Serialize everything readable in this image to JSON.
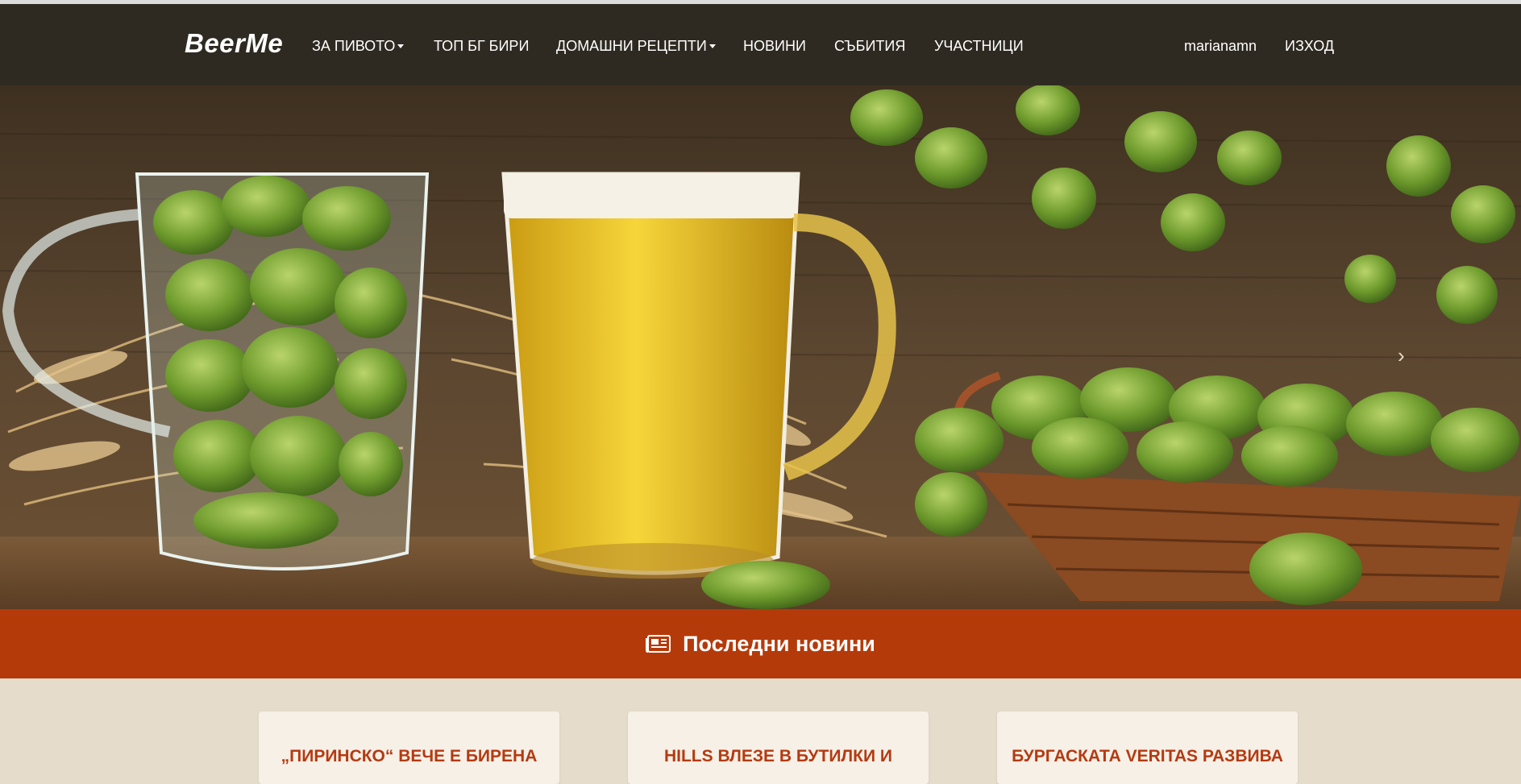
{
  "brand": "BeerMe",
  "nav": {
    "items": [
      {
        "label": "ЗА ПИВОТО",
        "dropdown": true
      },
      {
        "label": "ТОП БГ БИРИ",
        "dropdown": false
      },
      {
        "label": "ДОМАШНИ РЕЦЕПТИ",
        "dropdown": true
      },
      {
        "label": "НОВИНИ",
        "dropdown": false
      },
      {
        "label": "СЪБИТИЯ",
        "dropdown": false
      },
      {
        "label": "УЧАСТНИЦИ",
        "dropdown": false
      }
    ],
    "user": "marianamn",
    "logout": "ИЗХОД"
  },
  "hero": {
    "next_glyph": "›"
  },
  "news": {
    "heading": "Последни новини",
    "icon": "newspaper-icon",
    "cards": [
      {
        "title": "„ПИРИНСКО“ ВЕЧЕ Е БИРЕНА"
      },
      {
        "title": "HILLS ВЛЕЗЕ В БУТИЛКИ И"
      },
      {
        "title": "БУРГАСКАТА VERITAS РАЗВИВА"
      }
    ]
  },
  "colors": {
    "navbar": "#2e2a21",
    "news_band": "#b53a0a",
    "page_bg": "#e5dccb",
    "card_bg": "#f7f0e6",
    "card_title": "#b43a12"
  }
}
